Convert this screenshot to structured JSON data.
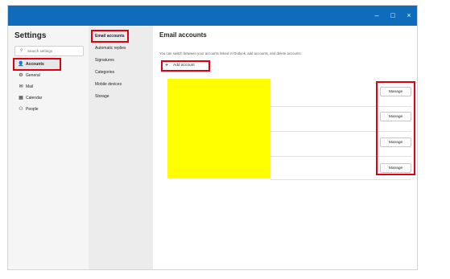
{
  "window": {
    "controls": {
      "minimize": "–",
      "maximize": "□",
      "close": "×"
    }
  },
  "settings": {
    "title": "Settings",
    "search_placeholder": "Search settings",
    "search_icon": "search-icon",
    "nav": [
      {
        "label": "Accounts",
        "icon": "person-icon",
        "glyph": "👤",
        "selected": true
      },
      {
        "label": "General",
        "icon": "gear-icon",
        "glyph": "⚙"
      },
      {
        "label": "Mail",
        "icon": "mail-icon",
        "glyph": "✉"
      },
      {
        "label": "Calendar",
        "icon": "calendar-icon",
        "glyph": "▦"
      },
      {
        "label": "People",
        "icon": "people-icon",
        "glyph": "⚇"
      }
    ]
  },
  "accounts_nav": [
    {
      "label": "Email accounts",
      "selected": true
    },
    {
      "label": "Automatic replies"
    },
    {
      "label": "Signatures"
    },
    {
      "label": "Categories"
    },
    {
      "label": "Mobile devices"
    },
    {
      "label": "Storage"
    }
  ],
  "main": {
    "title": "Email accounts",
    "description": "You can switch between your accounts linked in Outlook, add accounts, and delete accounts.",
    "add_account": {
      "label": "Add account",
      "icon": "plus-icon",
      "glyph": "+"
    },
    "accounts": [
      {
        "manage_label": "Manage"
      },
      {
        "manage_label": "Manage"
      },
      {
        "manage_label": "Manage"
      },
      {
        "manage_label": "Manage"
      }
    ]
  },
  "colors": {
    "titlebar": "#0f6cbd",
    "highlight": "#e0000f",
    "redaction": "#ffff00"
  }
}
